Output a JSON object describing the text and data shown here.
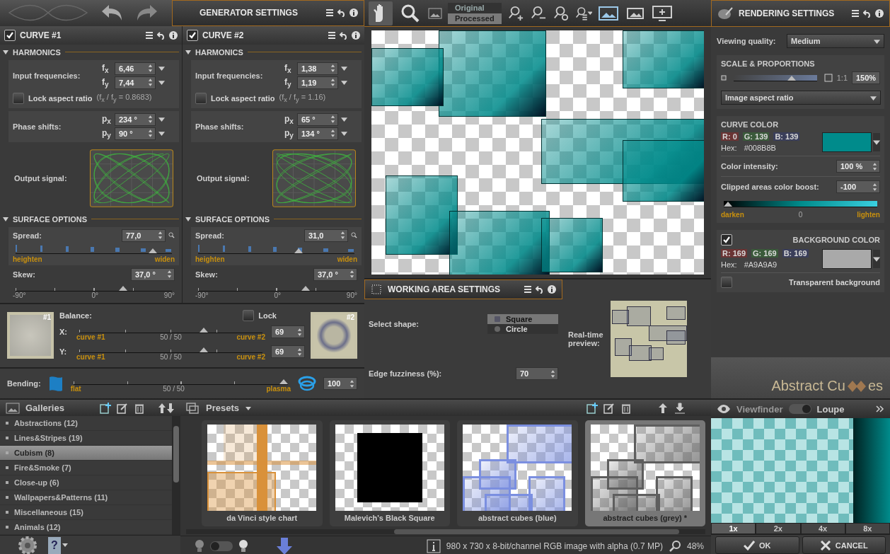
{
  "generator": {
    "title": "GENERATOR SETTINGS"
  },
  "curves": [
    {
      "title": "CURVE #1",
      "enabled": true,
      "harmonics_heading": "HARMONICS",
      "frequencies_label": "Input frequencies:",
      "frequencies": [
        {
          "symbol": "f$_{x}$",
          "value": "6,46"
        },
        {
          "symbol": "f$_{y}$",
          "value": "7,44"
        }
      ],
      "lock_aspect": {
        "label": "Lock aspect ratio",
        "checked": false,
        "ratio": "(f$_{x}$ / f$_{y}$ = 0.8683)"
      },
      "phase_label": "Phase shifts:",
      "phases": [
        {
          "symbol": "p$_{x}$",
          "value": "234 °"
        },
        {
          "symbol": "p$_{y}$",
          "value": "90 °"
        }
      ],
      "output_label": "Output signal:",
      "surface_heading": "SURFACE OPTIONS",
      "spread": {
        "label": "Spread:",
        "value": "77,0",
        "level": 0.9,
        "min_label": "heighten",
        "max_label": "widen"
      },
      "skew": {
        "label": "Skew:",
        "value": "37,0 °",
        "level": 0.7,
        "ticks": [
          "-90°",
          "0°",
          "90°"
        ]
      }
    },
    {
      "title": "CURVE #2",
      "enabled": true,
      "harmonics_heading": "HARMONICS",
      "frequencies_label": "Input frequencies:",
      "frequencies": [
        {
          "symbol": "f$_{x}$",
          "value": "1,38"
        },
        {
          "symbol": "f$_{y}$",
          "value": "1,19"
        }
      ],
      "lock_aspect": {
        "label": "Lock aspect ratio",
        "checked": false,
        "ratio": "(f$_{x}$ / f$_{y}$ = 1.16)"
      },
      "phase_label": "Phase shifts:",
      "phases": [
        {
          "symbol": "p$_{x}$",
          "value": "65 °"
        },
        {
          "symbol": "p$_{y}$",
          "value": "134 °"
        }
      ],
      "output_label": "Output signal:",
      "surface_heading": "SURFACE OPTIONS",
      "spread": {
        "label": "Spread:",
        "value": "31,0",
        "level": 0.65,
        "min_label": "heighten",
        "max_label": "widen"
      },
      "skew": {
        "label": "Skew:",
        "value": "37,0 °",
        "level": 0.7,
        "ticks": [
          "-90°",
          "0°",
          "90°"
        ]
      }
    }
  ],
  "balance": {
    "label": "Balance:",
    "thumb_labels": [
      "#1",
      "#2"
    ],
    "lock": {
      "label": "Lock",
      "checked": false
    },
    "axes": [
      {
        "label": "X:",
        "left": "curve #1",
        "center": "50 / 50",
        "right": "curve #2",
        "level": 0.69,
        "value": "69"
      },
      {
        "label": "Y:",
        "left": "curve #1",
        "center": "50 / 50",
        "right": "curve #2",
        "level": 0.69,
        "value": "69"
      }
    ]
  },
  "bending": {
    "label": "Bending:",
    "left": "flat",
    "center": "50 / 50",
    "right": "plasma",
    "level": 1.0,
    "value": "100"
  },
  "viewer": {
    "tools": [
      {
        "kind": "hand",
        "selected": true
      },
      {
        "kind": "zoom",
        "selected": false
      }
    ],
    "view_modes": [
      {
        "label": "Original",
        "selected": false
      },
      {
        "label": "Processed",
        "selected": true
      }
    ]
  },
  "rendering": {
    "title": "RENDERING SETTINGS",
    "quality": {
      "label": "Viewing quality:",
      "value": "Medium"
    },
    "scale": {
      "heading": "SCALE & PROPORTIONS",
      "level": 0.72,
      "ratio_label": "1:1",
      "value": "150%",
      "aspect": "Image aspect ratio"
    },
    "curve_color": {
      "heading": "CURVE COLOR",
      "r": "R:   0",
      "g": "G: 139",
      "b": "B: 139",
      "hex_label": "Hex:",
      "hex": "#008B8B",
      "color": "#008b8b"
    },
    "intensity": {
      "label": "Color intensity:",
      "value": "100 %"
    },
    "boost": {
      "label": "Clipped areas color boost:",
      "value": "-100",
      "level": 0.0,
      "min": "darken",
      "mid": "0",
      "max": "lighten"
    },
    "background_color": {
      "heading": "BACKGROUND COLOR",
      "checked": true,
      "r": "R: 169",
      "g": "G: 169",
      "b": "B: 169",
      "hex_label": "Hex:",
      "hex": "#A9A9A9",
      "color": "#a9a9a9"
    },
    "transparent": {
      "label": "Transparent background",
      "checked": false
    },
    "logo": [
      "Abstract Cu",
      "es"
    ]
  },
  "working_area": {
    "title": "WORKING AREA SETTINGS",
    "shape_label": "Select shape:",
    "shapes": [
      {
        "label": "Square",
        "selected": true
      },
      {
        "label": "Circle",
        "selected": false
      }
    ],
    "fuzziness": {
      "label": "Edge fuzziness (%):",
      "value": "70"
    },
    "preview_label": "Real-time preview:"
  },
  "galleries": {
    "title": "Galleries",
    "items": [
      {
        "label": "Abstractions (12)",
        "selected": false
      },
      {
        "label": "Lines&Stripes (19)",
        "selected": false
      },
      {
        "label": "Cubism (8)",
        "selected": true
      },
      {
        "label": "Fire&Smoke (7)",
        "selected": false
      },
      {
        "label": "Close-up (6)",
        "selected": false
      },
      {
        "label": "Wallpapers&Patterns (11)",
        "selected": false
      },
      {
        "label": "Miscellaneous (15)",
        "selected": false
      },
      {
        "label": "Animals (12)",
        "selected": false
      }
    ]
  },
  "presets": {
    "title": "Presets",
    "items": [
      {
        "caption": "da Vinci style chart",
        "kind": "cross",
        "color": "#d9913a",
        "selected": false
      },
      {
        "caption": "Malevich's Black Square",
        "kind": "block",
        "color": "#000000",
        "selected": false
      },
      {
        "caption": "abstract cubes (blue)",
        "kind": "cubes",
        "color": "#7b8fe0",
        "selected": false
      },
      {
        "caption": "abstract cubes (grey) *",
        "kind": "cubes",
        "color": "#5e5e5e",
        "selected": true
      }
    ]
  },
  "viewfinder": {
    "label": "Viewfinder",
    "loupe_on": true,
    "alt_label": "Loupe",
    "zooms": [
      {
        "label": "1x",
        "selected": true
      },
      {
        "label": "2x",
        "selected": false
      },
      {
        "label": "4x",
        "selected": false
      },
      {
        "label": "8x",
        "selected": false
      }
    ]
  },
  "status": {
    "info": "980 x 730 x 8-bit/channel RGB image with alpha  (0.7 MP)",
    "zoom": "48%",
    "light_on": false,
    "help_glyph": "?",
    "buttons": [
      {
        "kind": "ok",
        "label": "OK"
      },
      {
        "kind": "cancel",
        "label": "CANCEL"
      }
    ]
  }
}
